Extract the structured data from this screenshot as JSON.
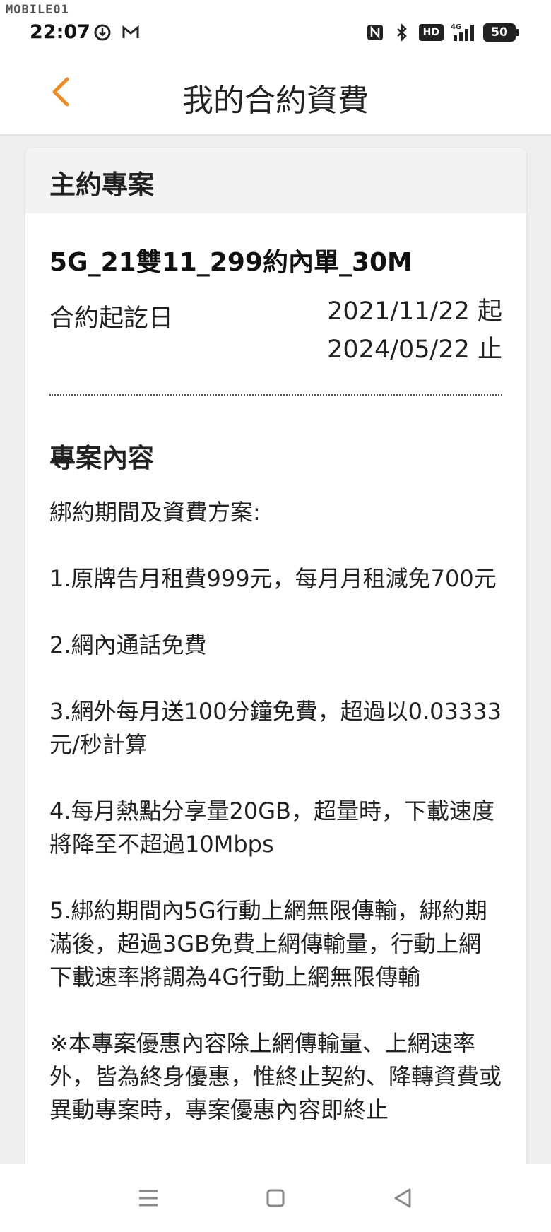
{
  "status_bar": {
    "watermark": "MOBILE01",
    "time": "22:07",
    "battery": "50",
    "hd": "HD",
    "network": "4G"
  },
  "header": {
    "title": "我的合約資費"
  },
  "colors": {
    "accent": "#f08a24",
    "background": "#efefef",
    "card": "#ffffff",
    "card_header": "#f3f3f3"
  },
  "card": {
    "header": "主約專案",
    "plan_name": "5G_21雙11_299約內單_30M",
    "contract_label": "合約起訖日",
    "contract_start": "2021/11/22 起",
    "contract_end": "2024/05/22 止",
    "section_title": "專案內容",
    "intro": "綁約期間及資費方案:",
    "items": [
      "1.原牌告月租費999元，每月月租減免700元",
      "2.網內通話免費",
      "3.網外每月送100分鐘免費，超過以0.03333元/秒計算",
      "4.每月熱點分享量20GB，超量時，下載速度將降至不超過10Mbps",
      "5.綁約期間內5G行動上網無限傳輸，綁約期滿後，超過3GB免費上網傳輸量，行動上網下載速率將調為4G行動上網無限傳輸",
      "※本專案優惠內容除上網傳輸量、上網速率外，皆為終身優惠，惟終止契約、降轉資費或異動專案時，專案優惠內容即終止"
    ]
  },
  "nav": {
    "menu_icon": "menu-icon",
    "home_icon": "square-icon",
    "back_icon": "triangle-back-icon"
  }
}
